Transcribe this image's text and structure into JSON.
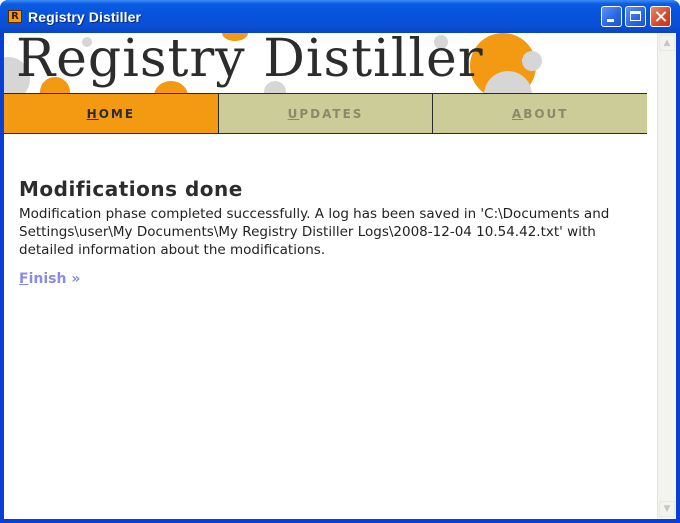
{
  "window": {
    "title": "Registry Distiller",
    "app_icon_letter": "R",
    "controls": [
      "minimize",
      "maximize",
      "close"
    ]
  },
  "banner": {
    "title": "Registry Distiller",
    "accent_color": "#f39a12",
    "bubble_color": "#d6d6d6"
  },
  "nav": {
    "tabs": [
      {
        "hotkey": "H",
        "rest": "OME",
        "active": true
      },
      {
        "hotkey": "U",
        "rest": "PDATES",
        "active": false
      },
      {
        "hotkey": "A",
        "rest": "BOUT",
        "active": false
      }
    ]
  },
  "content": {
    "heading": "Modifications done",
    "message": "Modification phase completed successfully. A log has been saved in 'C:\\Documents and Settings\\user\\My Documents\\My Registry Distiller Logs\\2008-12-04 10.54.42.txt' with detailed information about the modifications.",
    "finish": {
      "hotkey": "F",
      "rest": "inish",
      "suffix": " »"
    }
  },
  "scrollbar": {
    "up_glyph": "▲",
    "down_glyph": "▼"
  }
}
